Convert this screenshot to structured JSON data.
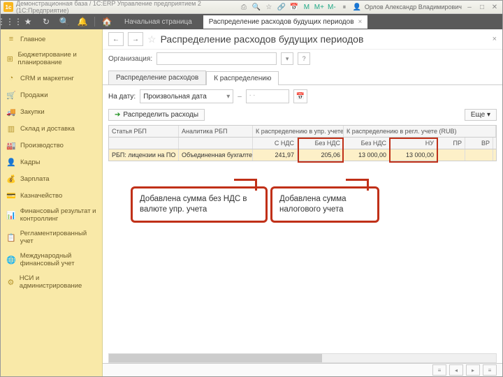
{
  "titlebar": {
    "text": "Демонстрационная база / 1С:ERP Управление предприятием 2  (1С:Предприятие)",
    "user": "Орлов Александр Владимирович"
  },
  "toolbar": {
    "start": "Начальная страница",
    "tab": "Распределение расходов будущих периодов"
  },
  "sidebar": {
    "items": [
      {
        "label": "Главное",
        "icon": "≡"
      },
      {
        "label": "Бюджетирование и планирование",
        "icon": "⊞"
      },
      {
        "label": "CRM и маркетинг",
        "icon": "◔"
      },
      {
        "label": "Продажи",
        "icon": "🛒"
      },
      {
        "label": "Закупки",
        "icon": "🚚"
      },
      {
        "label": "Склад и доставка",
        "icon": "▥"
      },
      {
        "label": "Производство",
        "icon": "🏭"
      },
      {
        "label": "Кадры",
        "icon": "👤"
      },
      {
        "label": "Зарплата",
        "icon": "💰"
      },
      {
        "label": "Казначейство",
        "icon": "💳"
      },
      {
        "label": "Финансовый результат и контроллинг",
        "icon": "📊"
      },
      {
        "label": "Регламентированный учет",
        "icon": "📋"
      },
      {
        "label": "Международный финансовый учет",
        "icon": "🌐"
      },
      {
        "label": "НСИ и администрирование",
        "icon": "⚙"
      }
    ]
  },
  "page": {
    "title": "Распределение расходов будущих периодов",
    "org_label": "Организация:",
    "link": "?"
  },
  "tabs": {
    "t1": "Распределение расходов",
    "t2": "К распределению"
  },
  "filter": {
    "date_label": "На дату:",
    "date_mode": "Произвольная дата",
    "ellipsis": ". ."
  },
  "actions": {
    "distribute": "Распределить расходы",
    "more": "Еще ▾"
  },
  "grid": {
    "h": {
      "article": "Статья РБП",
      "analytics": "Аналитика РБП",
      "upr": "К распределению в упр. учете (USD)",
      "regl": "К распределению в регл. учете (RUB)",
      "withvat": "С НДС",
      "novat": "Без НДС",
      "novat2": "Без НДС",
      "nu": "НУ",
      "pr": "ПР",
      "vr": "ВР"
    },
    "row": {
      "article": "РБП: лицензии на ПО",
      "analytics": "Объединенная бухгалте...",
      "withvat": "241,97",
      "novat": "205,06",
      "novat2": "13 000,00",
      "nu": "13 000,00"
    }
  },
  "call": {
    "c1": "Добавлена сумма без НДС в валюте упр. учета",
    "c2": "Добавлена сумма налогового учета"
  }
}
